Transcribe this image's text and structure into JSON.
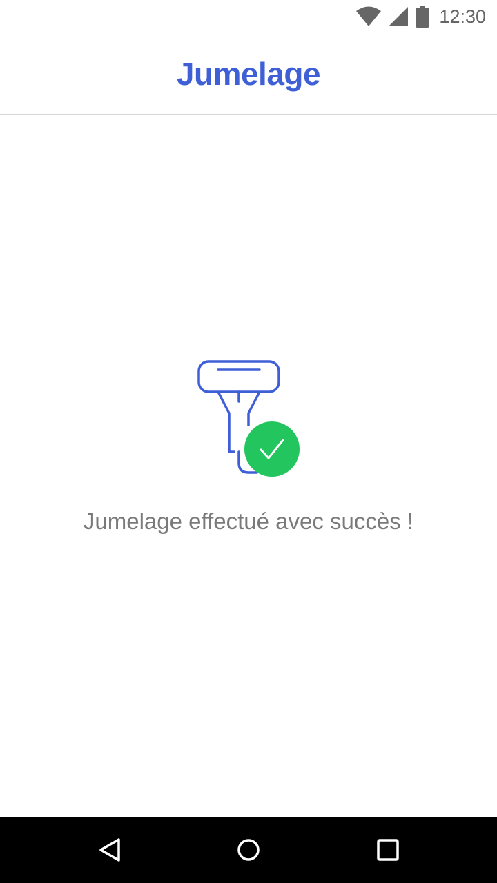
{
  "status_bar": {
    "time": "12:30",
    "icons": [
      "wifi-icon",
      "cellular-signal-icon",
      "battery-icon"
    ]
  },
  "header": {
    "title": "Jumelage"
  },
  "main": {
    "illustration_icon": "barcode-scanner-success-icon",
    "message": "Jumelage effectué avec succès !"
  },
  "nav_bar": {
    "buttons": [
      "back-icon",
      "home-icon",
      "recents-icon"
    ]
  },
  "colors": {
    "accent": "#3f5fd6",
    "success": "#22c55e",
    "text_secondary": "#7a7a7a",
    "nav_background": "#000000"
  }
}
